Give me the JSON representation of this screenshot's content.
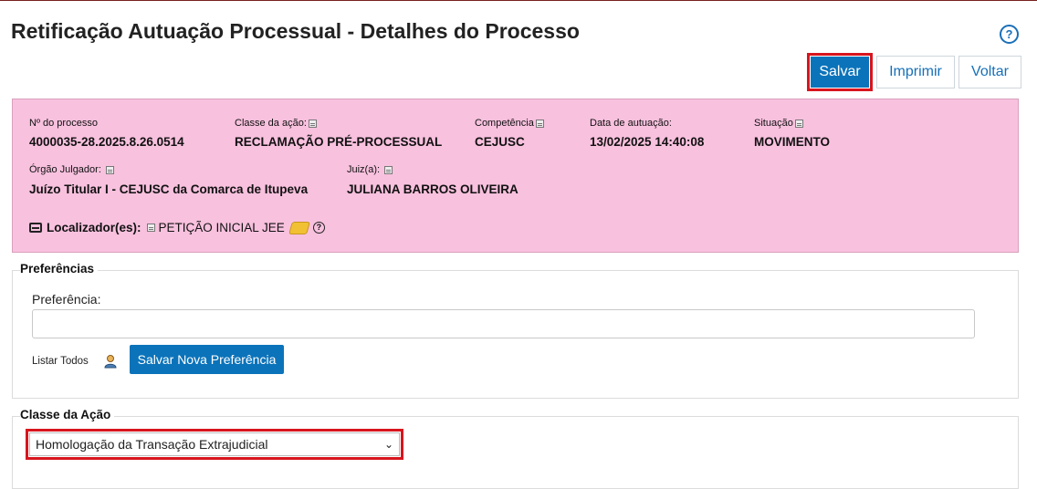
{
  "header": {
    "title": "Retificação Autuação Processual - Detalhes do Processo",
    "help_icon": "question-circle-icon"
  },
  "toolbar": {
    "save_label": "Salvar",
    "print_label": "Imprimir",
    "back_label": "Voltar"
  },
  "process": {
    "numero_label": "Nº do processo",
    "numero_value": "4000035-28.2025.8.26.0514",
    "classe_label": "Classe da ação:",
    "classe_value": "RECLAMAÇÃO PRÉ-PROCESSUAL",
    "competencia_label": "Competência",
    "competencia_value": "CEJUSC",
    "data_label": "Data de autuação:",
    "data_value": "13/02/2025 14:40:08",
    "situacao_label": "Situação",
    "situacao_value": "MOVIMENTO",
    "orgao_label": "Órgão Julgador:",
    "orgao_value": "Juízo Titular I - CEJUSC da Comarca de Itupeva",
    "juiz_label": "Juiz(a):",
    "juiz_value": "JULIANA BARROS OLIVEIRA",
    "localizador_label": "Localizador(es):",
    "localizador_value": "PETIÇÃO INICIAL JEE",
    "background_color": "#f8c1de"
  },
  "preferencias": {
    "legend": "Preferências",
    "field_label": "Preferência:",
    "field_value": "",
    "listar_todos": "Listar Todos",
    "save_new_label": "Salvar Nova Preferência"
  },
  "classe_acao": {
    "legend": "Classe da Ação",
    "selected": "Homologação da Transação Extrajudicial"
  },
  "colors": {
    "primary": "#0b73ba",
    "highlight": "#d8151e",
    "link": "#1670b8"
  }
}
